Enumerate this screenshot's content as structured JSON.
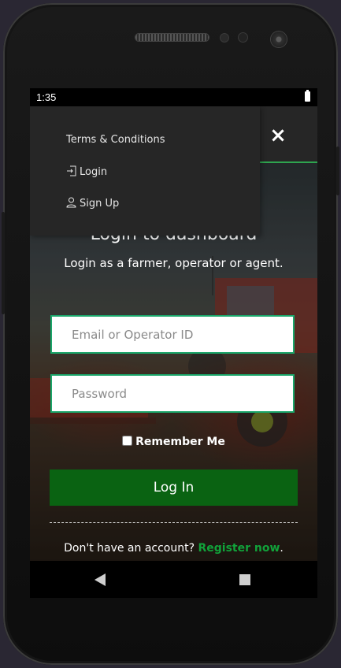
{
  "status_bar": {
    "time": "1:35"
  },
  "menu": {
    "items": [
      {
        "label": "Terms & Conditions",
        "icon": ""
      },
      {
        "label": "Login",
        "icon": "login-icon"
      },
      {
        "label": "Sign Up",
        "icon": "user-icon"
      }
    ]
  },
  "header": {
    "close_label": "×"
  },
  "login": {
    "title": "Login to dashboard",
    "subtitle": "Login as a farmer, operator or agent.",
    "email_placeholder": "Email or Operator ID",
    "password_placeholder": "Password",
    "remember_label": "Remember Me",
    "submit_label": "Log In",
    "signup_prompt": "Don't have an account? ",
    "signup_link": "Register now",
    "signup_suffix": "."
  },
  "colors": {
    "accent_green": "#0a6312",
    "link_green": "#11a23a",
    "input_border": "#1aa66a",
    "menu_bg": "#262626"
  }
}
